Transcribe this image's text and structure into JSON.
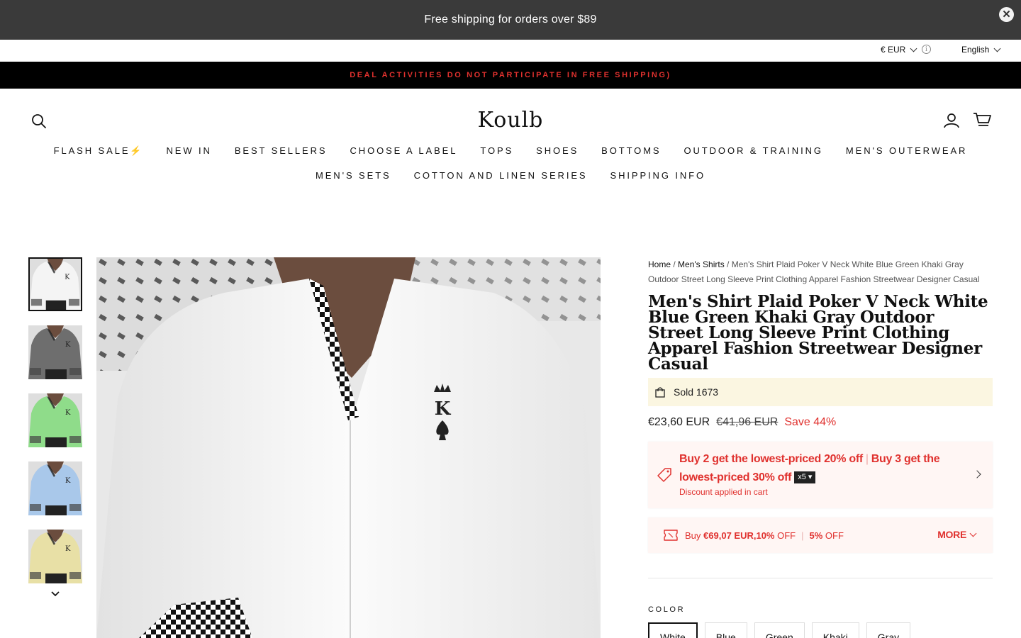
{
  "announcement": {
    "text": "Free shipping for orders over $89",
    "close": "✕"
  },
  "utility": {
    "currency": "€ EUR",
    "info": "i",
    "language": "English"
  },
  "promo_bar": {
    "text": "DEAL ACTIVITIES DO NOT PARTICIPATE IN FREE SHIPPING)"
  },
  "header": {
    "logo": "Koulb"
  },
  "nav": {
    "row1": [
      "FLASH SALE⚡",
      "NEW IN",
      "BEST SELLERS",
      "CHOOSE A LABEL",
      "TOPS",
      "SHOES",
      "BOTTOMS",
      "OUTDOOR & TRAINING",
      "MEN'S OUTERWEAR"
    ],
    "row2": [
      "MEN'S SETS",
      "COTTON AND LINEN SERIES",
      "SHIPPING INFO"
    ]
  },
  "gallery": {
    "thumbnail_colors": [
      "#f4f4f4",
      "#6e6e6e",
      "#8fdc8a",
      "#a9c8ea",
      "#e8e0a6"
    ],
    "selected_index": 0
  },
  "product": {
    "breadcrumb": {
      "home": "Home",
      "sep": "/",
      "category": "Men's Shirts",
      "current": "Men's Shirt Plaid Poker V Neck White Blue Green Khaki Gray Outdoor Street Long Sleeve Print Clothing Apparel Fashion Streetwear Designer Casual"
    },
    "title": "Men's Shirt Plaid Poker V Neck White Blue Green Khaki Gray Outdoor Street Long Sleeve Print Clothing Apparel Fashion Streetwear Designer Casual",
    "sold": "Sold 1673",
    "price": "€23,60 EUR",
    "compare_price": "€41,96 EUR",
    "save": "Save 44%",
    "promotion": {
      "part1": "Buy 2 get the lowest-priced 20% off",
      "sep": "|",
      "part2": "Buy 3 get the lowest-priced 30% off",
      "qty": "x5",
      "note": "Discount applied in cart"
    },
    "volume": {
      "prefix": "Buy",
      "amount": "€69,07 EUR,10%",
      "off1": "OFF",
      "sep": "|",
      "percent2": "5%",
      "off2": "OFF",
      "more": "MORE"
    },
    "color_label": "COLOR",
    "colors": [
      "White",
      "Blue",
      "Green",
      "Khaki",
      "Gray"
    ],
    "selected_color": "White"
  }
}
